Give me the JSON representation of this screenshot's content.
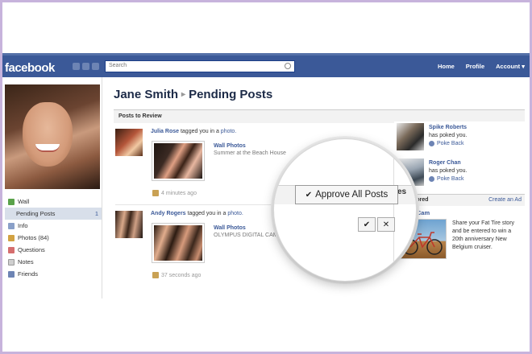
{
  "topbar": {
    "logo": "facebook",
    "search_placeholder": "Search",
    "nav": [
      "Home",
      "Profile",
      "Account ▾"
    ]
  },
  "left_nav": {
    "items": [
      {
        "label": "Wall",
        "icon": "wall-icon",
        "color": "#5aa24a"
      },
      {
        "label": "Pending Posts",
        "badge": "1",
        "active": true
      },
      {
        "label": "Info",
        "icon": "info-icon",
        "color": "#8aa0c8"
      },
      {
        "label": "Photos (84)",
        "icon": "photos-icon",
        "color": "#d2a243"
      },
      {
        "label": "Questions",
        "icon": "questions-icon",
        "color": "#d56e6e"
      },
      {
        "label": "Notes",
        "icon": "notes-icon",
        "color": "#cfcfcf"
      },
      {
        "label": "Friends",
        "icon": "friends-icon",
        "color": "#6d84b4"
      }
    ]
  },
  "page": {
    "name": "Jane Smith",
    "separator": "▸",
    "title": "Pending Posts"
  },
  "review": {
    "section_title": "Posts to Review",
    "approve_all": "Approve All Posts",
    "approve_symbol": "✔",
    "reject_symbol": "✕",
    "posts": [
      {
        "author": "Julia Rose",
        "action": "tagged you in a",
        "object": "photo.",
        "album": "Wall Photos",
        "caption": "Summer at the Beach House",
        "time": "4 minutes ago"
      },
      {
        "author": "Andy Rogers",
        "action": "tagged you in a",
        "object": "photo.",
        "album": "Wall Photos",
        "caption": "OLYMPUS DIGITAL CAMERA",
        "time": "37 seconds ago"
      }
    ]
  },
  "pokes": {
    "header": "es",
    "items": [
      {
        "name": "Spike Roberts",
        "message": "has poked you.",
        "action": "Poke Back"
      },
      {
        "name": "Roger Chan",
        "message": "has poked you.",
        "action": "Poke Back"
      }
    ]
  },
  "sponsored": {
    "title": "Sponsored",
    "create_ad": "Create an Ad",
    "ad_title": "FatTireCam",
    "ad_text": "Share your Fat Tire story and be entered to win a 20th anniversary New Belgium cruiser."
  }
}
